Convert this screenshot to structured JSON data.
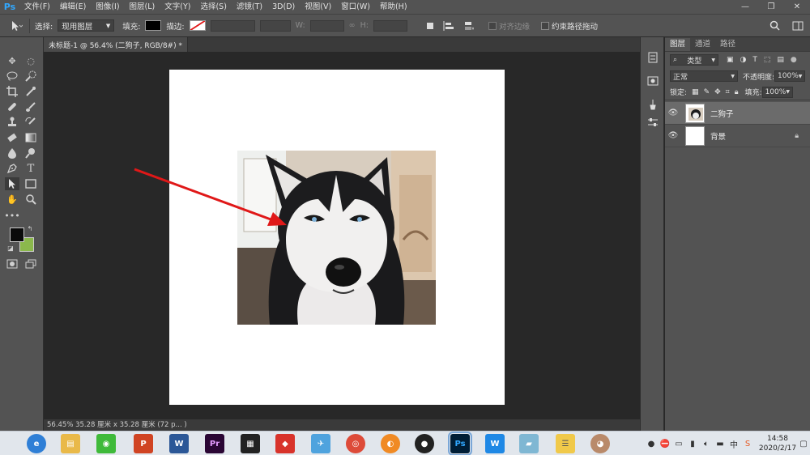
{
  "app": {
    "logo": "Ps"
  },
  "menu": [
    "文件(F)",
    "编辑(E)",
    "图像(I)",
    "图层(L)",
    "文字(Y)",
    "选择(S)",
    "滤镜(T)",
    "3D(D)",
    "视图(V)",
    "窗口(W)",
    "帮助(H)"
  ],
  "window_controls": {
    "minimize": "—",
    "maximize": "❐",
    "close": "✕"
  },
  "options": {
    "select_label": "选择:",
    "select_value": "现用图层",
    "fill_label": "填充:",
    "stroke_label": "描边:",
    "w_label": "W:",
    "h_label": "H:",
    "align_edges": "对齐边缘",
    "constrain_path": "约束路径拖动",
    "fill_color": "#000000"
  },
  "document": {
    "tab_title": "未标题-1 @ 56.4% (二狗子, RGB/8#) *",
    "close": "×",
    "status": "56.45%   35.28 厘米 x 35.28 厘米 (72 p... )"
  },
  "colors": {
    "foreground": "#0a0a0a",
    "background": "#8bb84c",
    "arrow": "#e01818"
  },
  "layers_panel": {
    "tabs": [
      "图层",
      "通道",
      "路径"
    ],
    "filter_label": "类型",
    "blend_mode": "正常",
    "opacity_label": "不透明度:",
    "opacity_value": "100%",
    "lock_label": "锁定:",
    "fill_label": "填充:",
    "fill_value": "100%",
    "layers": [
      {
        "name": "二狗子",
        "selected": true,
        "locked": false
      },
      {
        "name": "背景",
        "selected": false,
        "locked": true
      }
    ]
  },
  "taskbar": {
    "icons": [
      "browser-icon",
      "file-explorer-icon",
      "wechat-icon",
      "powerpoint-icon",
      "word-icon",
      "premiere-icon",
      "video-editor-icon",
      "game-icon",
      "qq-bird-icon",
      "chrome-icon",
      "app-orange-icon",
      "qq-icon",
      "photoshop-icon",
      "wps-icon",
      "notebook-icon",
      "notes-icon",
      "photo-icon"
    ],
    "time": "14:58",
    "date": "2020/2/17"
  }
}
